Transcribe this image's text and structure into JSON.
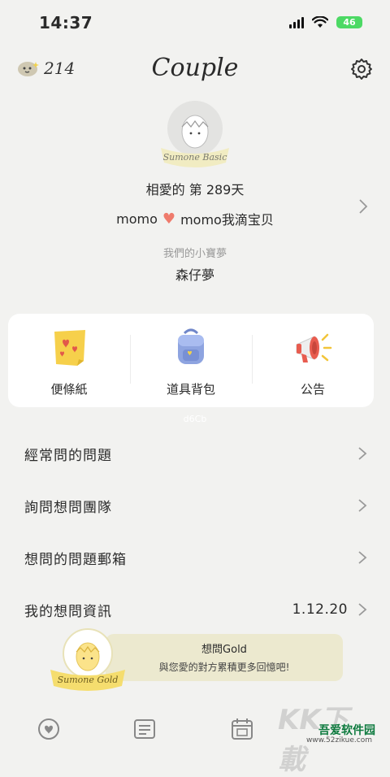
{
  "status": {
    "time": "14:37",
    "battery": "46"
  },
  "header": {
    "coins": "214",
    "title": "Couple"
  },
  "profile": {
    "badge_text": "Sumone Basic",
    "days_text": "相愛的 第 289天",
    "partner1": "momo",
    "partner2": "momo我滴宝贝",
    "baby_label": "我們的小寶夢",
    "baby_name": "森仔夢"
  },
  "quick": [
    {
      "label": "便條紙",
      "icon": "sticky-note-icon"
    },
    {
      "label": "道具背包",
      "icon": "backpack-icon"
    },
    {
      "label": "公告",
      "icon": "megaphone-icon"
    }
  ],
  "quick_hint": "d6Cb",
  "menu": [
    {
      "label": "經常問的問題"
    },
    {
      "label": "詢問想問團隊"
    },
    {
      "label": "想問的問題郵箱"
    },
    {
      "label": "我的想問資訊",
      "value": "1.12.20"
    }
  ],
  "promo": {
    "title": "想問Gold",
    "subtitle": "與您愛的對方累積更多回憶吧!",
    "badge_text": "Sumone Gold"
  },
  "watermark": {
    "big": "KK下載",
    "name": "吾爱软件园",
    "url": "www.52zikue.com"
  },
  "colors": {
    "heart": "#ef7b6c",
    "promo_bg": "#ece9cf",
    "battery": "#4cd964"
  }
}
